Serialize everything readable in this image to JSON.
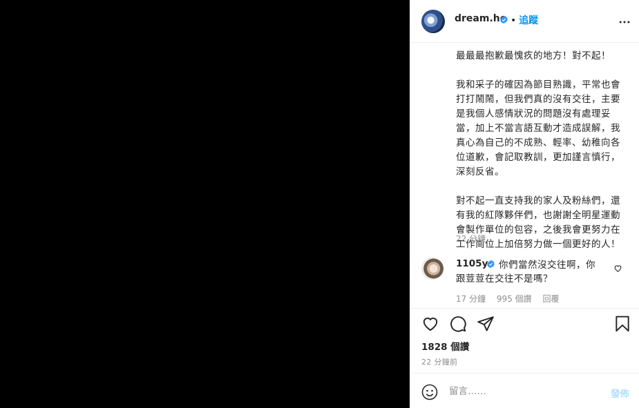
{
  "post": {
    "username": "dream.ho",
    "follow_label": "追蹤",
    "separator": "•",
    "caption": "最最最抱歉最愧疚的地方！對不起！\n\n我和采子的確因為節目熟識，平常也會打打鬧鬧，但我們真的沒有交往，主要是我個人感情狀況的問題沒有處理妥當，加上不當言語互動才造成誤解，我真心為自己的不成熟、輕率、幼稚向各位道歉，會記取教訓，更加謹言慎行，深刻反省。\n\n對不起一直支持我的家人及粉絲們，還有我的紅隊夥伴們，也謝謝全明星運動會製作單位的包容，之後我會更努力在工作崗位上加倍努力做一個更好的人！",
    "caption_time": "22 分鐘"
  },
  "comment": {
    "username": "1105ya",
    "text": "你們當然沒交往啊，你跟荳荳在交往不是嗎？",
    "time": "17 分鐘",
    "likes": "995 個讚",
    "reply_label": "回覆"
  },
  "actions": {
    "likes_count": "1828 個讚",
    "post_time": "22 分鐘前"
  },
  "add_comment": {
    "placeholder": "留言……",
    "post_label": "發佈"
  },
  "colors": {
    "media_bg": "#000000",
    "accent": "#0095f6",
    "muted": "#8e8e8e",
    "verified": "#3897f0"
  },
  "icons": {
    "verified": "verified-badge-icon",
    "more": "more-options-icon",
    "heart": "heart-icon",
    "comment": "comment-icon",
    "share": "share-icon",
    "save": "bookmark-icon",
    "emoji": "emoji-icon"
  }
}
